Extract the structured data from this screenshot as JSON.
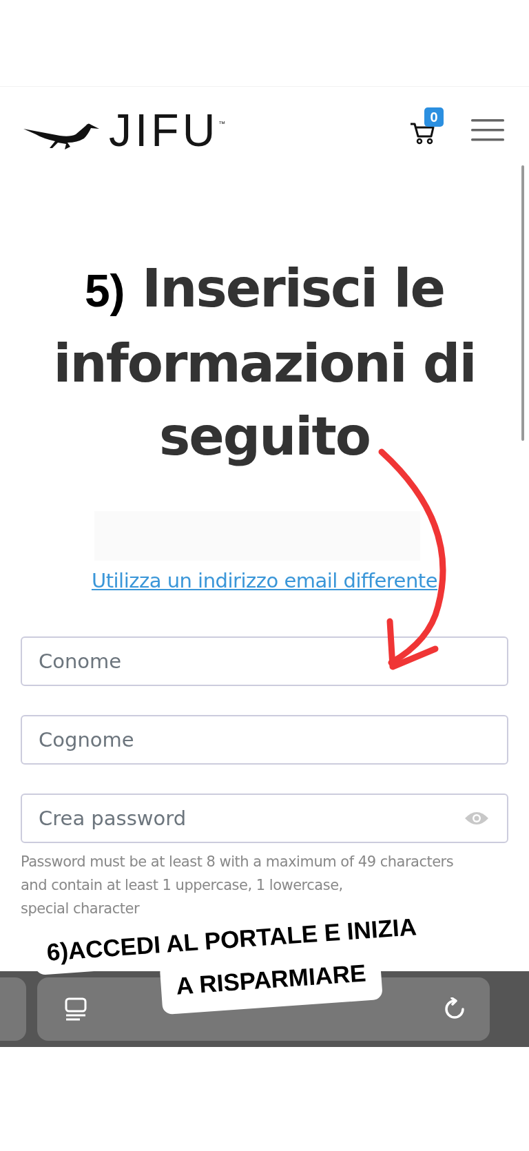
{
  "header": {
    "logo_text": "JIFU",
    "trademark": "™",
    "cart_count": "0"
  },
  "heading": {
    "step": "5)",
    "title": "Inserisci le informazioni di seguito"
  },
  "link": "Utilizza un indirizzo email differente",
  "fields": [
    {
      "kind": "text",
      "placeholder": "Conome"
    },
    {
      "kind": "text",
      "placeholder": "Cognome"
    },
    {
      "kind": "password",
      "placeholder": "Crea password"
    }
  ],
  "password_hint": [
    "Password must be at least 8 with a maximum of 49 characters",
    "and contain at least 1 uppercase, 1 lowercase,",
    "special character"
  ],
  "annotation": [
    "6)ACCEDI AL PORTALE E INIZIA",
    "A RISPARMIARE"
  ]
}
